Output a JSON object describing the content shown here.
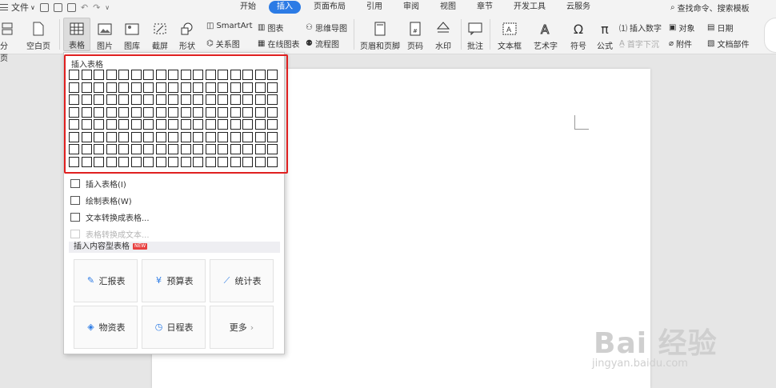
{
  "menubar": {
    "file_label": "文件",
    "tabs": [
      "开始",
      "插入",
      "页面布局",
      "引用",
      "审阅",
      "视图",
      "章节",
      "开发工具",
      "云服务"
    ],
    "search_text": "查找命令、搜索模板"
  },
  "ribbon": {
    "paging": "分页",
    "blank_page": "空白页",
    "table": "表格",
    "picture": "图片",
    "gallery": "图库",
    "screenshot": "截屏",
    "shape": "形状",
    "smartart": "SmartArt",
    "chart": "图表",
    "relation": "关系图",
    "online_chart": "在线图表",
    "mindmap": "思维导图",
    "flowchart": "流程图",
    "header_footer": "页眉和页脚",
    "page_number": "页码",
    "watermark": "水印",
    "comment": "批注",
    "textbox": "文本框",
    "wordart": "艺术字",
    "symbol": "符号",
    "formula": "公式",
    "insert_number": "插入数字",
    "dropcap": "首字下沉",
    "object": "对象",
    "attachment": "附件",
    "date": "日期",
    "doc_parts": "文档部件"
  },
  "dropdown": {
    "grid_title": "插入表格",
    "grid_cols": 17,
    "grid_rows": 8,
    "items": [
      {
        "label": "插入表格(I)",
        "enabled": true
      },
      {
        "label": "绘制表格(W)",
        "enabled": true
      },
      {
        "label": "文本转换成表格...",
        "enabled": true
      },
      {
        "label": "表格转换成文本...",
        "enabled": false
      }
    ],
    "section_title": "插入内容型表格",
    "new_badge": "NEW",
    "cards": [
      {
        "label": "汇报表",
        "icon": "edit-icon"
      },
      {
        "label": "预算表",
        "icon": "yen-icon"
      },
      {
        "label": "统计表",
        "icon": "chart-icon"
      },
      {
        "label": "物资表",
        "icon": "box-icon"
      },
      {
        "label": "日程表",
        "icon": "clock-icon"
      },
      {
        "label": "更多",
        "icon": "chevron-right-icon"
      }
    ]
  },
  "watermark": {
    "brand": "Bai 经验",
    "url": "jingyan.baidu.com"
  },
  "colors": {
    "accent": "#2c7be5",
    "highlight_border": "#e02020"
  }
}
